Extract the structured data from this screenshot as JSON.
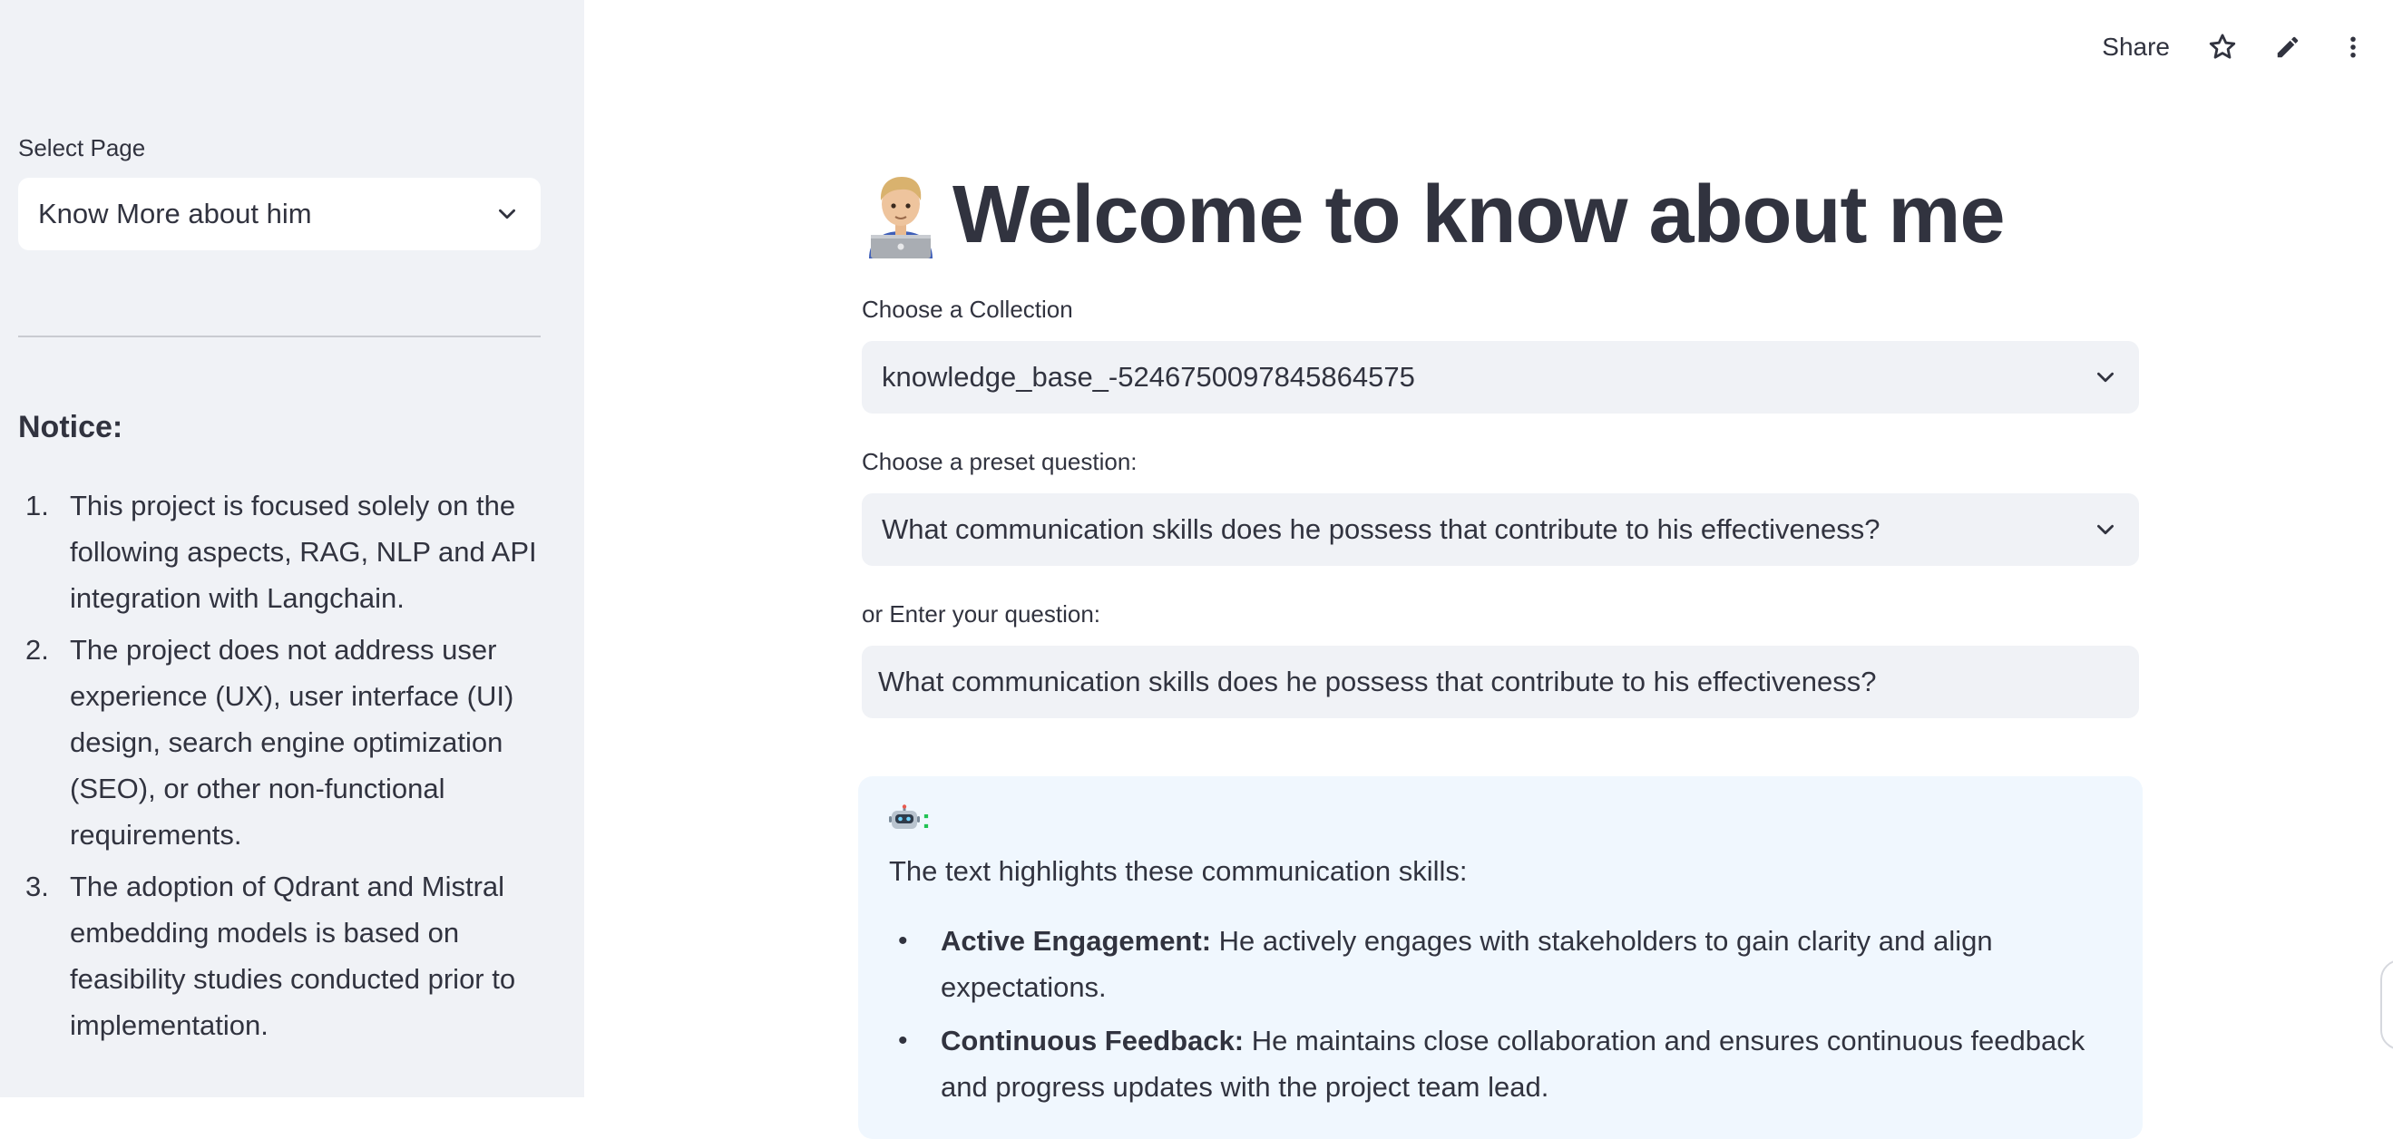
{
  "sidebar": {
    "select_label": "Select Page",
    "select_value": "Know More about him",
    "notice_title": "Notice:",
    "notices": [
      {
        "num": "1.",
        "text": "This project is focused solely on the following aspects, RAG, NLP and API integration with Langchain."
      },
      {
        "num": "2.",
        "text": "The project does not address user experience (UX), user interface (UI) design, search engine optimization (SEO), or other non-functional requirements."
      },
      {
        "num": "3.",
        "text": "The adoption of Qdrant and Mistral embedding models is based on feasibility studies conducted prior to implementation."
      }
    ]
  },
  "topbar": {
    "share_label": "Share",
    "icons": [
      "star-icon",
      "pencil-icon",
      "more-vertical-icon"
    ]
  },
  "main": {
    "title": "Welcome to know about me",
    "title_emoji": "technologist-emoji",
    "collection_label": "Choose a Collection",
    "collection_value": "knowledge_base_-5246750097845864575",
    "preset_label": "Choose a preset question:",
    "preset_value": "What communication skills does he possess that contribute to his effectiveness?",
    "question_label": "or Enter your question:",
    "question_value": "What communication skills does he possess that contribute to his effectiveness?",
    "answer": {
      "bot_icon": "robot-icon",
      "bot_suffix": ":",
      "intro": "The text highlights these communication skills:",
      "skills": [
        {
          "title": "Active Engagement:",
          "text": " He actively engages with stakeholders to gain clarity and align expectations."
        },
        {
          "title": "Continuous Feedback:",
          "text": " He maintains close collaboration and ensures continuous feedback and progress updates with the project team lead."
        }
      ]
    }
  },
  "colors": {
    "sidebar_bg": "#f0f2f6",
    "input_bg": "#f0f2f6",
    "answer_bg": "#f0f7fe",
    "text": "#31333f"
  }
}
